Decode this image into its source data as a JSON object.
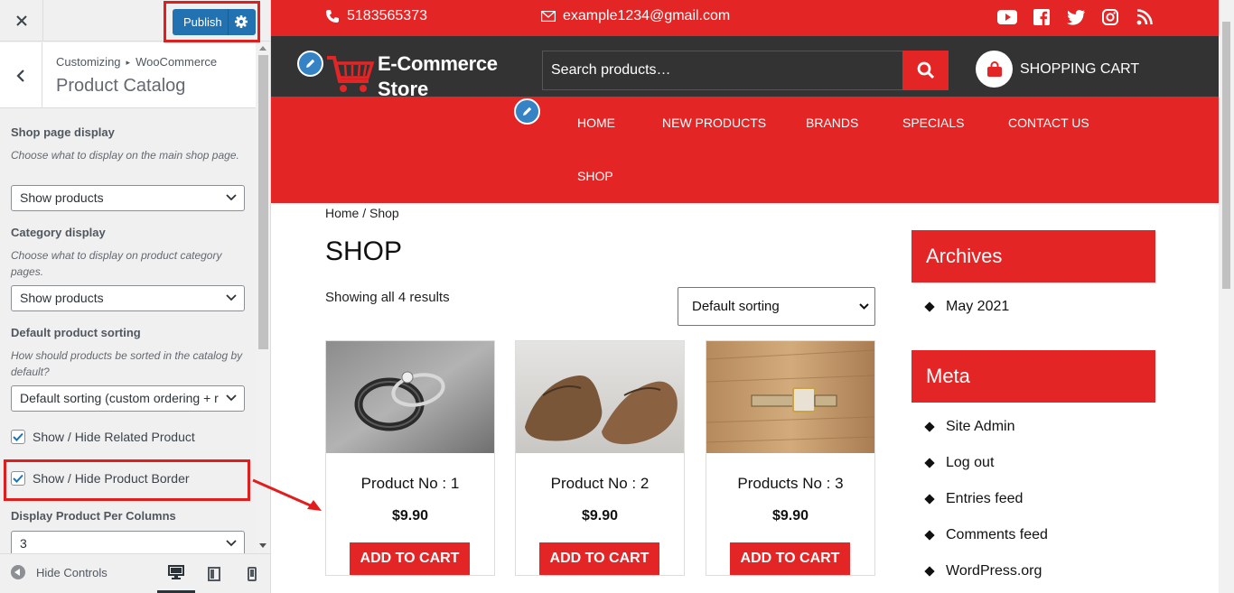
{
  "customizer": {
    "publish_label": "Publish",
    "breadcrumb_root": "Customizing",
    "breadcrumb_parent": "WooCommerce",
    "section_title": "Product Catalog",
    "controls": {
      "shop_page_display": {
        "title": "Shop page display",
        "description": "Choose what to display on the main shop page.",
        "value": "Show products"
      },
      "category_display": {
        "title": "Category display",
        "description": "Choose what to display on product category pages.",
        "value": "Show products"
      },
      "default_sorting": {
        "title": "Default product sorting",
        "description": "How should products be sorted in the catalog by default?",
        "value": "Default sorting (custom ordering + r"
      },
      "related_product": {
        "label": "Show / Hide Related Product",
        "checked": true
      },
      "product_border": {
        "label": "Show / Hide Product Border",
        "checked": true
      },
      "per_columns": {
        "title": "Display Product Per Columns",
        "value": "3"
      }
    },
    "hide_controls_label": "Hide Controls",
    "devices": [
      "desktop-icon",
      "tablet-icon",
      "mobile-icon"
    ],
    "accent": "#2271b1",
    "highlight": "#e01e1e"
  },
  "site": {
    "brand_color": "#e32526",
    "dark_bar_color": "#333333",
    "phone": "5183565373",
    "email": "example1234@gmail.com",
    "socials": [
      "youtube-icon",
      "facebook-icon",
      "twitter-icon",
      "instagram-icon",
      "rss-icon"
    ],
    "logo_line1": "E-Commerce",
    "logo_line2": "Store",
    "search_placeholder": "Search products…",
    "cart_label": "SHOPPING CART",
    "nav": [
      "HOME",
      "NEW PRODUCTS",
      "BRANDS",
      "SPECIALS",
      "CONTACT US",
      "SHOP"
    ],
    "breadcrumb": "Home / Shop",
    "page_title": "SHOP",
    "result_count": "Showing all 4 results",
    "sorting_value": "Default sorting",
    "products": [
      {
        "name": "Product No : 1",
        "price": "$9.90",
        "button": "ADD TO CART",
        "image": "rings"
      },
      {
        "name": "Product No : 2",
        "price": "$9.90",
        "button": "ADD TO CART",
        "image": "shoes"
      },
      {
        "name": "Products No : 3",
        "price": "$9.90",
        "button": "ADD TO CART",
        "image": "watch"
      }
    ],
    "widgets": {
      "archives_title": "Archives",
      "archives": [
        "May 2021"
      ],
      "meta_title": "Meta",
      "meta": [
        "Site Admin",
        "Log out",
        "Entries feed",
        "Comments feed",
        "WordPress.org"
      ]
    }
  }
}
